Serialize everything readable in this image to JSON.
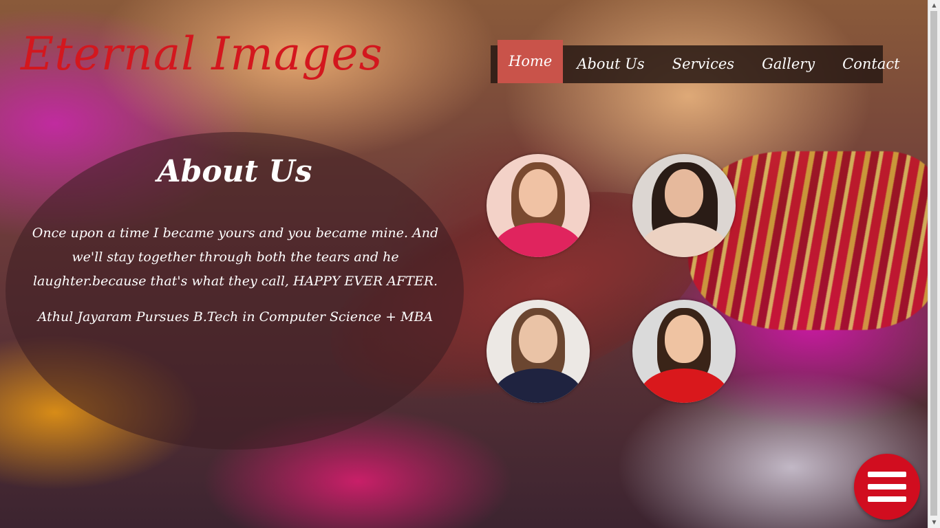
{
  "site": {
    "logo_text": "Eternal Images",
    "accent_color": "#d3171e",
    "nav_active_color": "#c9534a"
  },
  "nav": {
    "items": [
      {
        "label": "Home",
        "active": true
      },
      {
        "label": "About Us",
        "active": false
      },
      {
        "label": "Services",
        "active": false
      },
      {
        "label": "Gallery",
        "active": false
      },
      {
        "label": "Contact",
        "active": false
      }
    ]
  },
  "about": {
    "title": "About Us",
    "text": "Once upon a time I became yours and you became mine. And we'll stay together through both the tears and he laughter.because that's what they call, HAPPY EVER AFTER.",
    "credit": "Athul Jayaram Pursues B.Tech in Computer Science + MBA"
  },
  "gallery": {
    "photos": [
      {
        "name": "portrait-photo-1"
      },
      {
        "name": "portrait-photo-2"
      },
      {
        "name": "portrait-photo-3"
      },
      {
        "name": "portrait-photo-4"
      }
    ]
  },
  "menu_button": {
    "icon": "hamburger-menu-icon",
    "color": "#d10d1f"
  }
}
